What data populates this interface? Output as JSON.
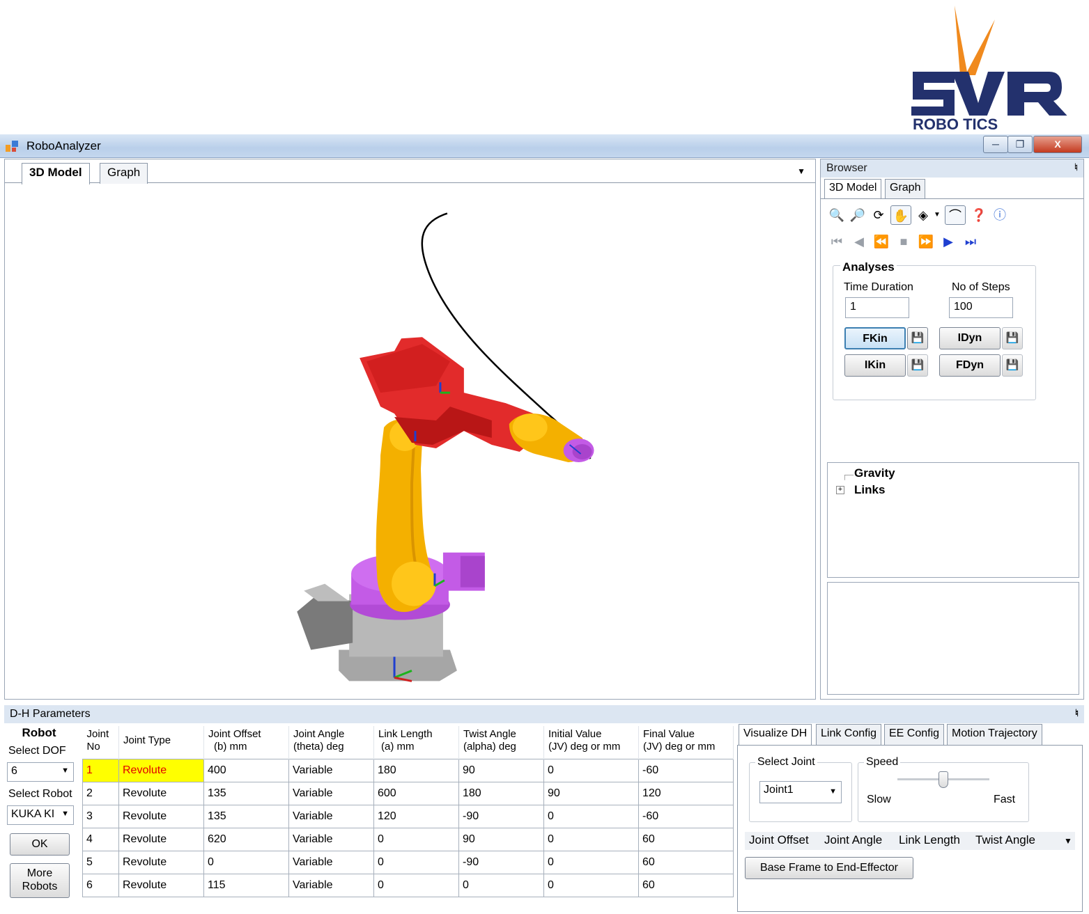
{
  "logo": {
    "text": "ROBO TICS",
    "letters": "SVR"
  },
  "window": {
    "title": "RoboAnalyzer",
    "close_label": "X"
  },
  "doc_tabs": [
    {
      "label": "3D Model"
    },
    {
      "label": "Graph"
    }
  ],
  "browser": {
    "header": "Browser",
    "tabs": [
      {
        "label": "3D Model"
      },
      {
        "label": "Graph"
      }
    ],
    "toolbar_icons": [
      "zoom-in-icon",
      "zoom-out-icon",
      "rotate-icon",
      "pan-hand-icon",
      "view-cube-icon",
      "trajectory-icon",
      "help-icon",
      "info-icon"
    ],
    "playback_icons": [
      "first-frame-icon",
      "step-back-icon",
      "play-back-icon",
      "stop-icon",
      "play-icon",
      "step-forward-icon",
      "last-frame-icon"
    ],
    "analyses": {
      "legend": "Analyses",
      "time_duration_label": "Time Duration",
      "time_duration_value": "1",
      "steps_label": "No of Steps",
      "steps_value": "100",
      "buttons": {
        "fkin": "FKin",
        "ikin": "IKin",
        "idyn": "IDyn",
        "fdyn": "FDyn"
      }
    },
    "tree": [
      {
        "label": "Gravity"
      },
      {
        "label": "Links",
        "expander": "+"
      }
    ]
  },
  "dh": {
    "header": "D-H Parameters",
    "robot_title": "Robot",
    "select_dof_label": "Select DOF",
    "dof_value": "6",
    "select_robot_label": "Select Robot",
    "robot_value": "KUKA KI",
    "ok_label": "OK",
    "more_robots_line1": "More",
    "more_robots_line2": "Robots",
    "columns": [
      [
        "Joint",
        "No"
      ],
      [
        "Joint Type",
        ""
      ],
      [
        "Joint Offset",
        "(b) mm"
      ],
      [
        "Joint Angle",
        "(theta) deg"
      ],
      [
        "Link Length",
        "(a) mm"
      ],
      [
        "Twist Angle",
        "(alpha) deg"
      ],
      [
        "Initial Value",
        "(JV) deg or mm"
      ],
      [
        "Final Value",
        "(JV) deg or mm"
      ]
    ],
    "rows": [
      [
        "1",
        "Revolute",
        "400",
        "Variable",
        "180",
        "90",
        "0",
        "-60"
      ],
      [
        "2",
        "Revolute",
        "135",
        "Variable",
        "600",
        "180",
        "90",
        "120"
      ],
      [
        "3",
        "Revolute",
        "135",
        "Variable",
        "120",
        "-90",
        "0",
        "-60"
      ],
      [
        "4",
        "Revolute",
        "620",
        "Variable",
        "0",
        "90",
        "0",
        "60"
      ],
      [
        "5",
        "Revolute",
        "0",
        "Variable",
        "0",
        "-90",
        "0",
        "60"
      ],
      [
        "6",
        "Revolute",
        "115",
        "Variable",
        "0",
        "0",
        "0",
        "60"
      ]
    ]
  },
  "visualize": {
    "tabs": [
      {
        "label": "Visualize DH"
      },
      {
        "label": "Link Config"
      },
      {
        "label": "EE Config"
      },
      {
        "label": "Motion Trajectory"
      }
    ],
    "select_joint_legend": "Select Joint",
    "select_joint_value": "Joint1",
    "speed_legend": "Speed",
    "slow_label": "Slow",
    "fast_label": "Fast",
    "speed_level": 0.5,
    "chips": [
      "Joint Offset",
      "Joint Angle",
      "Link Length",
      "Twist Angle"
    ],
    "base_frame_button": "Base Frame to End-Effector"
  }
}
